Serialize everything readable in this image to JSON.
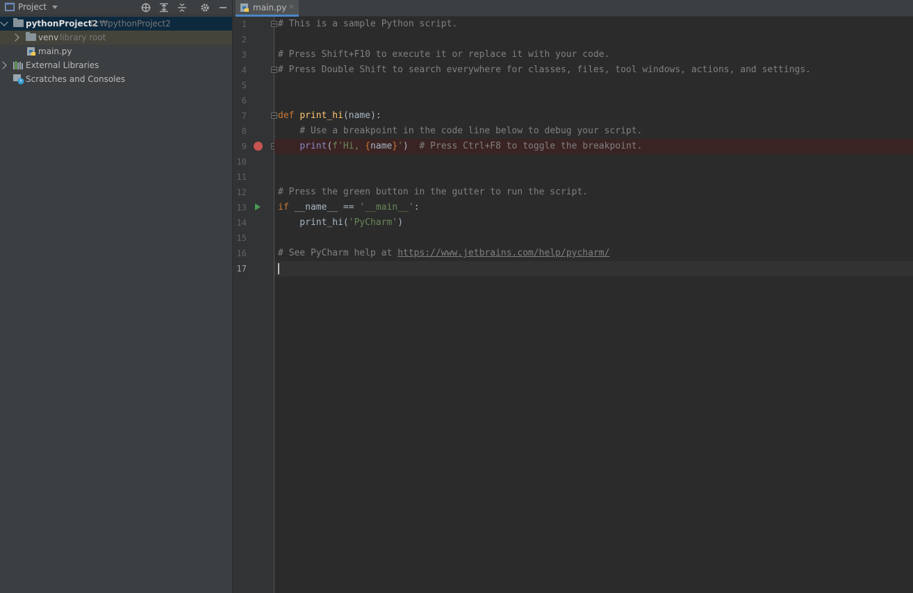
{
  "project_panel": {
    "title": "Project",
    "tree": [
      {
        "label": "pythonProject2",
        "sub": "D:₩pythonProject2"
      },
      {
        "label": "venv",
        "sub": "library root"
      },
      {
        "label": "main.py"
      },
      {
        "label": "External Libraries"
      },
      {
        "label": "Scratches and Consoles"
      }
    ]
  },
  "editor": {
    "tab_label": "main.py",
    "tab_close": "×",
    "line_numbers": [
      "1",
      "2",
      "3",
      "4",
      "5",
      "6",
      "7",
      "8",
      "9",
      "10",
      "11",
      "12",
      "13",
      "14",
      "15",
      "16",
      "17"
    ],
    "current_line": 17,
    "breakpoint_line": 9,
    "run_line": 13,
    "lines": {
      "l1": "# This is a sample Python script.",
      "l3": "# Press Shift+F10 to execute it or replace it with your code.",
      "l4": "# Press Double Shift to search everywhere for classes, files, tool windows, actions, and settings.",
      "l7_kw": "def",
      "l7_fn": "print_hi",
      "l7_rest": "(name):",
      "l8": "    # Use a breakpoint in the code line below to debug your script.",
      "l9_indent": "    ",
      "l9_bi": "print",
      "l9_p1": "(",
      "l9_st1": "f'Hi, ",
      "l9_brace1": "{",
      "l9_var": "name",
      "l9_brace2": "}",
      "l9_st2": "'",
      "l9_p2": ")",
      "l9_cmt": "  # Press Ctrl+F8 to toggle the breakpoint.",
      "l12": "# Press the green button in the gutter to run the script.",
      "l13_kw": "if",
      "l13_mid": " __name__ == ",
      "l13_st": "'__main__'",
      "l13_end": ":",
      "l14_a": "    print_hi(",
      "l14_st": "'PyCharm'",
      "l14_b": ")",
      "l16_cmt": "# See PyCharm help at ",
      "l16_link": "https://www.jetbrains.com/help/pycharm/"
    }
  },
  "icons": {
    "project_window": "project-window-icon",
    "locate": "crosshair-icon",
    "expand_all": "expand-all-icon",
    "collapse_all": "collapse-all-icon",
    "settings": "gear-icon",
    "hide": "minimize-icon"
  },
  "colors": {
    "background": "#2b2b2b",
    "panel": "#3c3f41",
    "selection": "#0d293e",
    "breakpoint": "#c75450",
    "run": "#499c54",
    "tab_underline": "#4a88c7"
  }
}
